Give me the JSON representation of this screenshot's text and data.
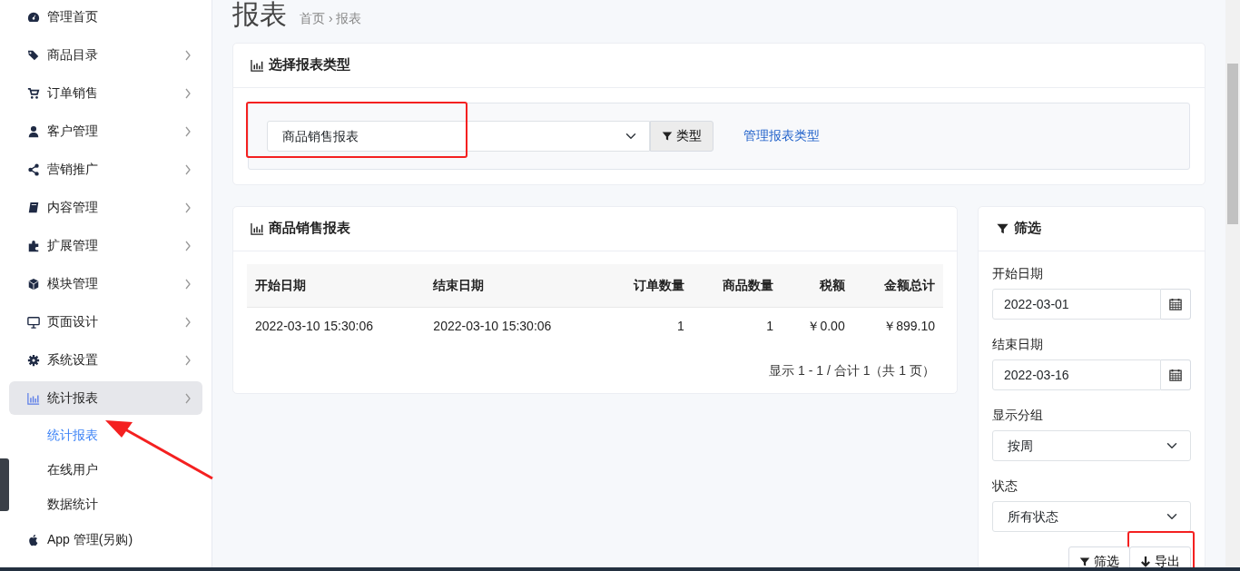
{
  "sidebar": {
    "items": [
      {
        "label": "管理首页",
        "kind": "link",
        "selected": false
      },
      {
        "label": "商品目录",
        "kind": "group",
        "selected": false
      },
      {
        "label": "订单销售",
        "kind": "group",
        "selected": false
      },
      {
        "label": "客户管理",
        "kind": "group",
        "selected": false
      },
      {
        "label": "营销推广",
        "kind": "group",
        "selected": false
      },
      {
        "label": "内容管理",
        "kind": "group",
        "selected": false
      },
      {
        "label": "扩展管理",
        "kind": "group",
        "selected": false
      },
      {
        "label": "模块管理",
        "kind": "group",
        "selected": false
      },
      {
        "label": "页面设计",
        "kind": "group",
        "selected": false
      },
      {
        "label": "系统设置",
        "kind": "group",
        "selected": false
      },
      {
        "label": "统计报表",
        "kind": "group",
        "selected": true,
        "children": [
          {
            "label": "统计报表",
            "selected": true,
            "pointed_at": true
          },
          {
            "label": "在线用户",
            "selected": false,
            "pointed_at": false
          },
          {
            "label": "数据统计",
            "selected": false,
            "pointed_at": false
          }
        ]
      },
      {
        "label": "App 管理(另购)",
        "kind": "link",
        "selected": false
      }
    ]
  },
  "page": {
    "title": "报表",
    "breadcrumb": [
      "首页",
      "›",
      "报表"
    ]
  },
  "report_type_card": {
    "title": "选择报表类型",
    "select": {
      "value": "商品销售报表",
      "highlighted": true
    },
    "type_button": "类型",
    "manage_link": "管理报表类型"
  },
  "report_card": {
    "title": "商品销售报表",
    "table": {
      "columns": [
        {
          "label": "开始日期",
          "numeric": false
        },
        {
          "label": "结束日期",
          "numeric": false
        },
        {
          "label": "订单数量",
          "numeric": true
        },
        {
          "label": "商品数量",
          "numeric": true
        },
        {
          "label": "税额",
          "numeric": true
        },
        {
          "label": "金额总计",
          "numeric": true
        }
      ],
      "rows": [
        [
          "2022-03-10 15:30:06",
          "2022-03-10 15:30:06",
          "1",
          "1",
          "￥0.00",
          "￥899.10"
        ]
      ]
    },
    "pagination": "显示 1 - 1 / 合计 1（共 1 页）"
  },
  "filter_card": {
    "title": "筛选",
    "fields": [
      {
        "kind": "date",
        "label": "开始日期",
        "value": "2022-03-01"
      },
      {
        "kind": "date",
        "label": "结束日期",
        "value": "2022-03-16"
      },
      {
        "kind": "select",
        "label": "显示分组",
        "value": "按周"
      },
      {
        "kind": "select",
        "label": "状态",
        "value": "所有状态"
      }
    ],
    "buttons": [
      {
        "kind": "filter",
        "label": "筛选",
        "highlighted": false
      },
      {
        "kind": "export",
        "label": "导出",
        "highlighted": true
      }
    ]
  }
}
